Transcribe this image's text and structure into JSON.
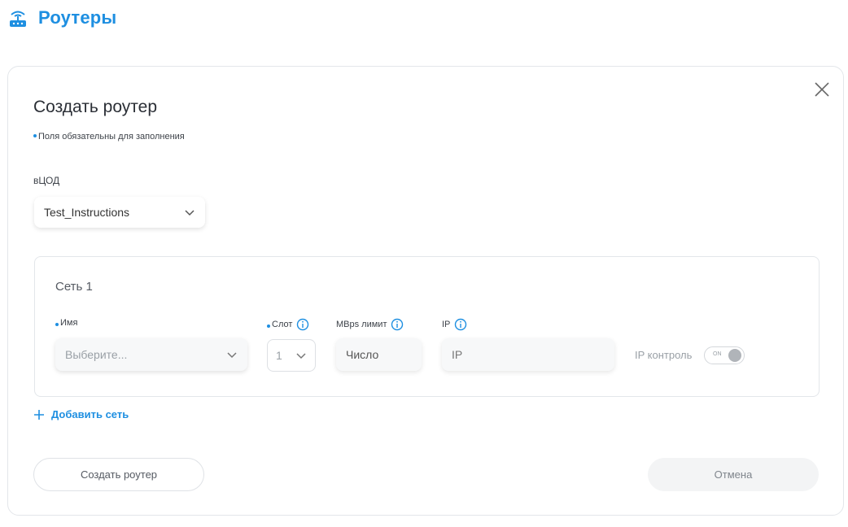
{
  "header": {
    "title": "Роутеры",
    "icon": "router-icon"
  },
  "dialog": {
    "title": "Создать роутер",
    "required_note": "Поля обязательны для заполнения",
    "vcod": {
      "label": "вЦОД",
      "value": "Test_Instructions"
    },
    "network": {
      "title": "Сеть 1",
      "name": {
        "label": "Имя",
        "placeholder": "Выберите..."
      },
      "slot": {
        "label": "Слот",
        "value": "1"
      },
      "mbps": {
        "label": "MBps лимит",
        "placeholder": "Число"
      },
      "ip": {
        "label": "IP",
        "placeholder": "IP"
      },
      "ip_control": {
        "label": "IP контроль",
        "toggle_text": "ON",
        "state": "off"
      }
    },
    "add_network": "Добавить сеть",
    "create_button": "Создать роутер",
    "cancel_button": "Отмена"
  },
  "colors": {
    "accent": "#1e8fe1",
    "border": "#e3e6ea",
    "muted": "#9aa0a6"
  }
}
